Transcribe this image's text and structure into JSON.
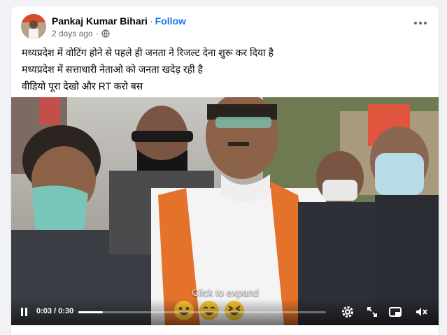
{
  "post": {
    "author": "Pankaj Kumar Bihari",
    "separator": "·",
    "follow_label": "Follow",
    "timestamp": "2 days ago",
    "visibility_icon": "globe-icon",
    "menu_icon": "more-options-icon",
    "lines": [
      "मध्यप्रदेश में वोटिंग होने से पहले ही जनता ने रिजल्ट देना शुरू कर दिया है",
      "मध्यप्रदेश में सत्ताधारी नेताओ को जनता खदेड़ रही है",
      "वीडियो पूरा देखो और RT करो बस"
    ]
  },
  "video": {
    "overlay_text": "Click to expand",
    "time_label": "0:03 / 0:30",
    "progress_fraction": 0.1,
    "emoji_names": [
      "grinning-emoji",
      "laughing-emoji",
      "squinting-laugh-emoji"
    ]
  },
  "colors": {
    "link_blue": "#1877f2",
    "muted": "#65676b",
    "page_bg": "#f0f2f5"
  }
}
